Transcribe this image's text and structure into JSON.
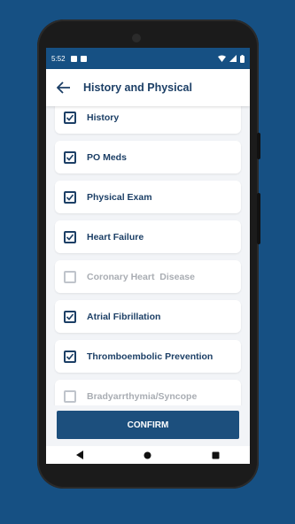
{
  "status_bar": {
    "time": "5:52"
  },
  "header": {
    "title": "History and Physical"
  },
  "items": [
    {
      "label": "History",
      "checked": true
    },
    {
      "label": "PO Meds",
      "checked": true
    },
    {
      "label": "Physical Exam",
      "checked": true
    },
    {
      "label": "Heart Failure",
      "checked": true
    },
    {
      "label": "Coronary Heart  Disease",
      "checked": false
    },
    {
      "label": "Atrial Fibrillation",
      "checked": true
    },
    {
      "label": "Thromboembolic Prevention",
      "checked": true
    },
    {
      "label": "Bradyarrthymia/Syncope",
      "checked": false
    }
  ],
  "footer": {
    "confirm_label": "CONFIRM"
  },
  "colors": {
    "primary": "#165083",
    "text": "#1c3f66",
    "disabled": "#a9adb3"
  }
}
